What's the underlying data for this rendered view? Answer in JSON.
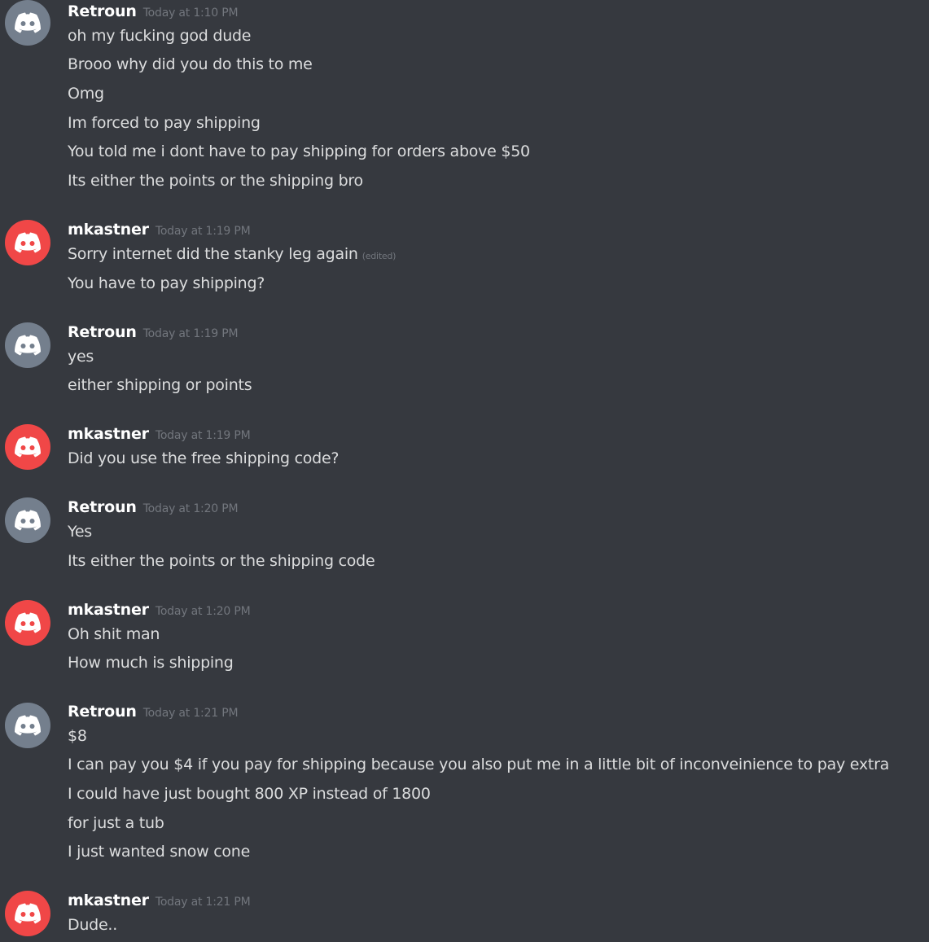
{
  "colors": {
    "background": "#36393f",
    "username": "#ffffff",
    "message_text": "#dcddde",
    "timestamp": "#72767d",
    "avatar_grey": "#747f8d",
    "avatar_red": "#f04747"
  },
  "groups": [
    {
      "author": "Retroun",
      "timestamp": "Today at 1:10 PM",
      "avatar_icon": "discord-logo-icon",
      "avatar_color": "#747f8d",
      "messages": [
        {
          "text": "oh my fucking god dude"
        },
        {
          "text": "Brooo why did you do this to me"
        },
        {
          "text": "Omg"
        },
        {
          "text": "Im forced to pay shipping"
        },
        {
          "text": "You told me i dont have to pay shipping for orders above $50"
        },
        {
          "text": "Its either the points or the shipping bro"
        }
      ]
    },
    {
      "author": "mkastner",
      "timestamp": "Today at 1:19 PM",
      "avatar_icon": "discord-logo-icon",
      "avatar_color": "#f04747",
      "messages": [
        {
          "text": "Sorry internet did the stanky leg again",
          "edited": "(edited)"
        },
        {
          "text": "You have to pay shipping?"
        }
      ]
    },
    {
      "author": "Retroun",
      "timestamp": "Today at 1:19 PM",
      "avatar_icon": "discord-logo-icon",
      "avatar_color": "#747f8d",
      "messages": [
        {
          "text": "yes"
        },
        {
          "text": "either shipping or points"
        }
      ]
    },
    {
      "author": "mkastner",
      "timestamp": "Today at 1:19 PM",
      "avatar_icon": "discord-logo-icon",
      "avatar_color": "#f04747",
      "messages": [
        {
          "text": "Did you use the free shipping code?"
        }
      ]
    },
    {
      "author": "Retroun",
      "timestamp": "Today at 1:20 PM",
      "avatar_icon": "discord-logo-icon",
      "avatar_color": "#747f8d",
      "messages": [
        {
          "text": "Yes"
        },
        {
          "text": "Its either the points or the shipping code"
        }
      ]
    },
    {
      "author": "mkastner",
      "timestamp": "Today at 1:20 PM",
      "avatar_icon": "discord-logo-icon",
      "avatar_color": "#f04747",
      "messages": [
        {
          "text": "Oh shit man"
        },
        {
          "text": "How much is shipping"
        }
      ]
    },
    {
      "author": "Retroun",
      "timestamp": "Today at 1:21 PM",
      "avatar_icon": "discord-logo-icon",
      "avatar_color": "#747f8d",
      "messages": [
        {
          "text": "$8"
        },
        {
          "text": "I can pay you $4 if you pay for shipping because you also put me in a little bit of inconveinience to pay extra"
        },
        {
          "text": "I could have just bought 800 XP instead of 1800"
        },
        {
          "text": "for just a tub"
        },
        {
          "text": "I just wanted snow cone"
        }
      ]
    },
    {
      "author": "mkastner",
      "timestamp": "Today at 1:21 PM",
      "avatar_icon": "discord-logo-icon",
      "avatar_color": "#f04747",
      "messages": [
        {
          "text": "Dude.."
        }
      ]
    }
  ]
}
